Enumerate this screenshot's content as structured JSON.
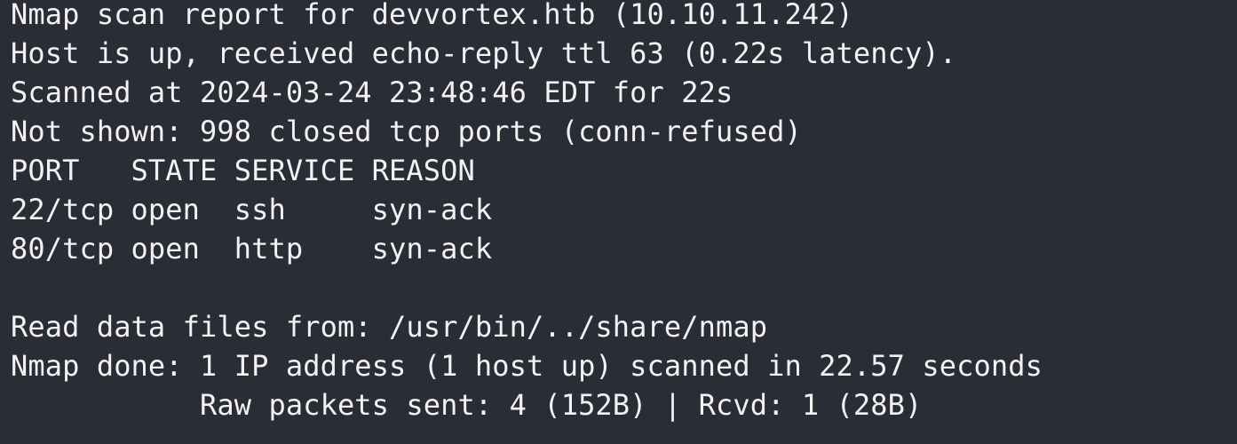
{
  "terminal": {
    "lines": [
      "Nmap scan report for devvortex.htb (10.10.11.242)",
      "Host is up, received echo-reply ttl 63 (0.22s latency).",
      "Scanned at 2024-03-24 23:48:46 EDT for 22s",
      "Not shown: 998 closed tcp ports (conn-refused)",
      "PORT   STATE SERVICE REASON",
      "22/tcp open  ssh     syn-ack",
      "80/tcp open  http    syn-ack",
      "",
      "Read data files from: /usr/bin/../share/nmap",
      "Nmap done: 1 IP address (1 host up) scanned in 22.57 seconds",
      "           Raw packets sent: 4 (152B) | Rcvd: 1 (28B)"
    ]
  },
  "colors": {
    "background": "#2a2c36",
    "foreground": "#f2f2f2"
  }
}
